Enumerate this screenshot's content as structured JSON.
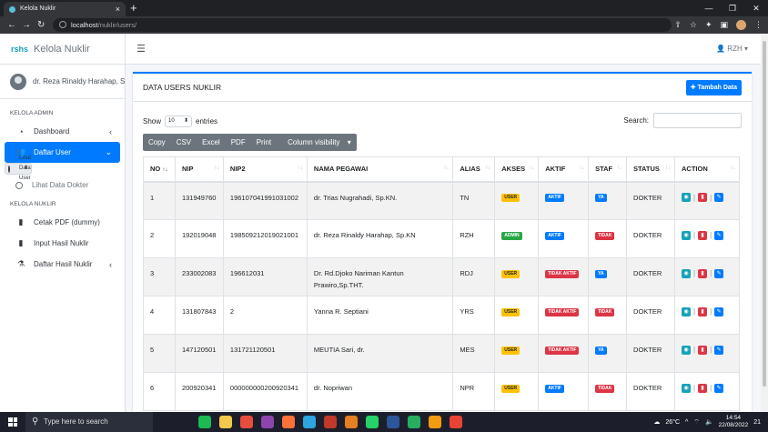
{
  "browser": {
    "tab_title": "Kelola Nuklir",
    "tab_close": "×",
    "new_tab": "+",
    "url_host": "localhost",
    "url_path": "/nuklir/users/",
    "win_min": "—",
    "win_max": "❐",
    "win_close": "✕"
  },
  "sidebar": {
    "brand_logo": "rshs",
    "brand_name": "Kelola Nuklir",
    "user_name": "dr. Reza Rinaldy Harahap, Sp.KN",
    "section_admin": "KELOLA ADMIN",
    "section_nuklir": "KELOLA NUKLIR",
    "items": [
      {
        "label": "Dashboard",
        "icon": "tachometer-icon"
      },
      {
        "label": "Daftar User",
        "icon": "users-icon"
      },
      {
        "label": "Lihat Data User",
        "icon": "circle-icon"
      },
      {
        "label": "Lihat Data Dokter",
        "icon": "circle-icon"
      },
      {
        "label": "Cetak PDF (dummy)",
        "icon": "file-icon"
      },
      {
        "label": "Input Hasil Nuklir",
        "icon": "file-icon"
      },
      {
        "label": "Daftar Hasil Nuklir",
        "icon": "flask-icon"
      }
    ]
  },
  "topbar": {
    "user_short": "RZH"
  },
  "card": {
    "title": "DATA USERS NUKLIR",
    "add_button": "Tambah Data",
    "show_label": "Show",
    "entries_value": "10",
    "entries_label": "entries",
    "search_label": "Search:",
    "export_buttons": [
      "Copy",
      "CSV",
      "Excel",
      "PDF",
      "Print",
      "Column visibility"
    ]
  },
  "table": {
    "headers": [
      "NO",
      "NIP",
      "NIP2",
      "NAMA PEGAWAI",
      "ALIAS",
      "AKSES",
      "AKTIF",
      "STAF",
      "STATUS",
      "ACTION"
    ],
    "rows": [
      {
        "no": "1",
        "nip": "131949760",
        "nip2": "196107041991031002",
        "nama": "dr. Trias Nugrahadi, Sp.KN.",
        "alias": "TN",
        "akses": "USER",
        "aktif": "AKTIF",
        "staf": "YA",
        "status": "DOKTER"
      },
      {
        "no": "2",
        "nip": "192019048",
        "nip2": "198509212019021001",
        "nama": "dr. Reza Rinaldy Harahap, Sp.KN",
        "alias": "RZH",
        "akses": "ADMIN",
        "aktif": "AKTIF",
        "staf": "TIDAK",
        "status": "DOKTER"
      },
      {
        "no": "3",
        "nip": "233002083",
        "nip2": "196612031",
        "nama": "Dr. Rd.Djoko Nariman Kantun Prawiro,Sp.THT.",
        "alias": "RDJ",
        "akses": "USER",
        "aktif": "TIDAK AKTIF",
        "staf": "YA",
        "status": "DOKTER"
      },
      {
        "no": "4",
        "nip": "131807843",
        "nip2": "2",
        "nama": "Yanna R. Septiani",
        "alias": "YRS",
        "akses": "USER",
        "aktif": "TIDAK AKTIF",
        "staf": "TIDAK",
        "status": "DOKTER"
      },
      {
        "no": "5",
        "nip": "147120501",
        "nip2": "131721120501",
        "nama": "MEUTIA Sari, dr.",
        "alias": "MES",
        "akses": "USER",
        "aktif": "TIDAK AKTIF",
        "staf": "YA",
        "status": "DOKTER"
      },
      {
        "no": "6",
        "nip": "200920341",
        "nip2": "000000000200920341",
        "nama": "dr. Nopriwan",
        "alias": "NPR",
        "akses": "USER",
        "aktif": "AKTIF",
        "staf": "TIDAK",
        "status": "DOKTER"
      }
    ]
  },
  "taskbar": {
    "search_placeholder": "Type here to search",
    "weather": "26°C",
    "time": "14:54",
    "date": "22/08/2022",
    "notif_count": "21"
  }
}
